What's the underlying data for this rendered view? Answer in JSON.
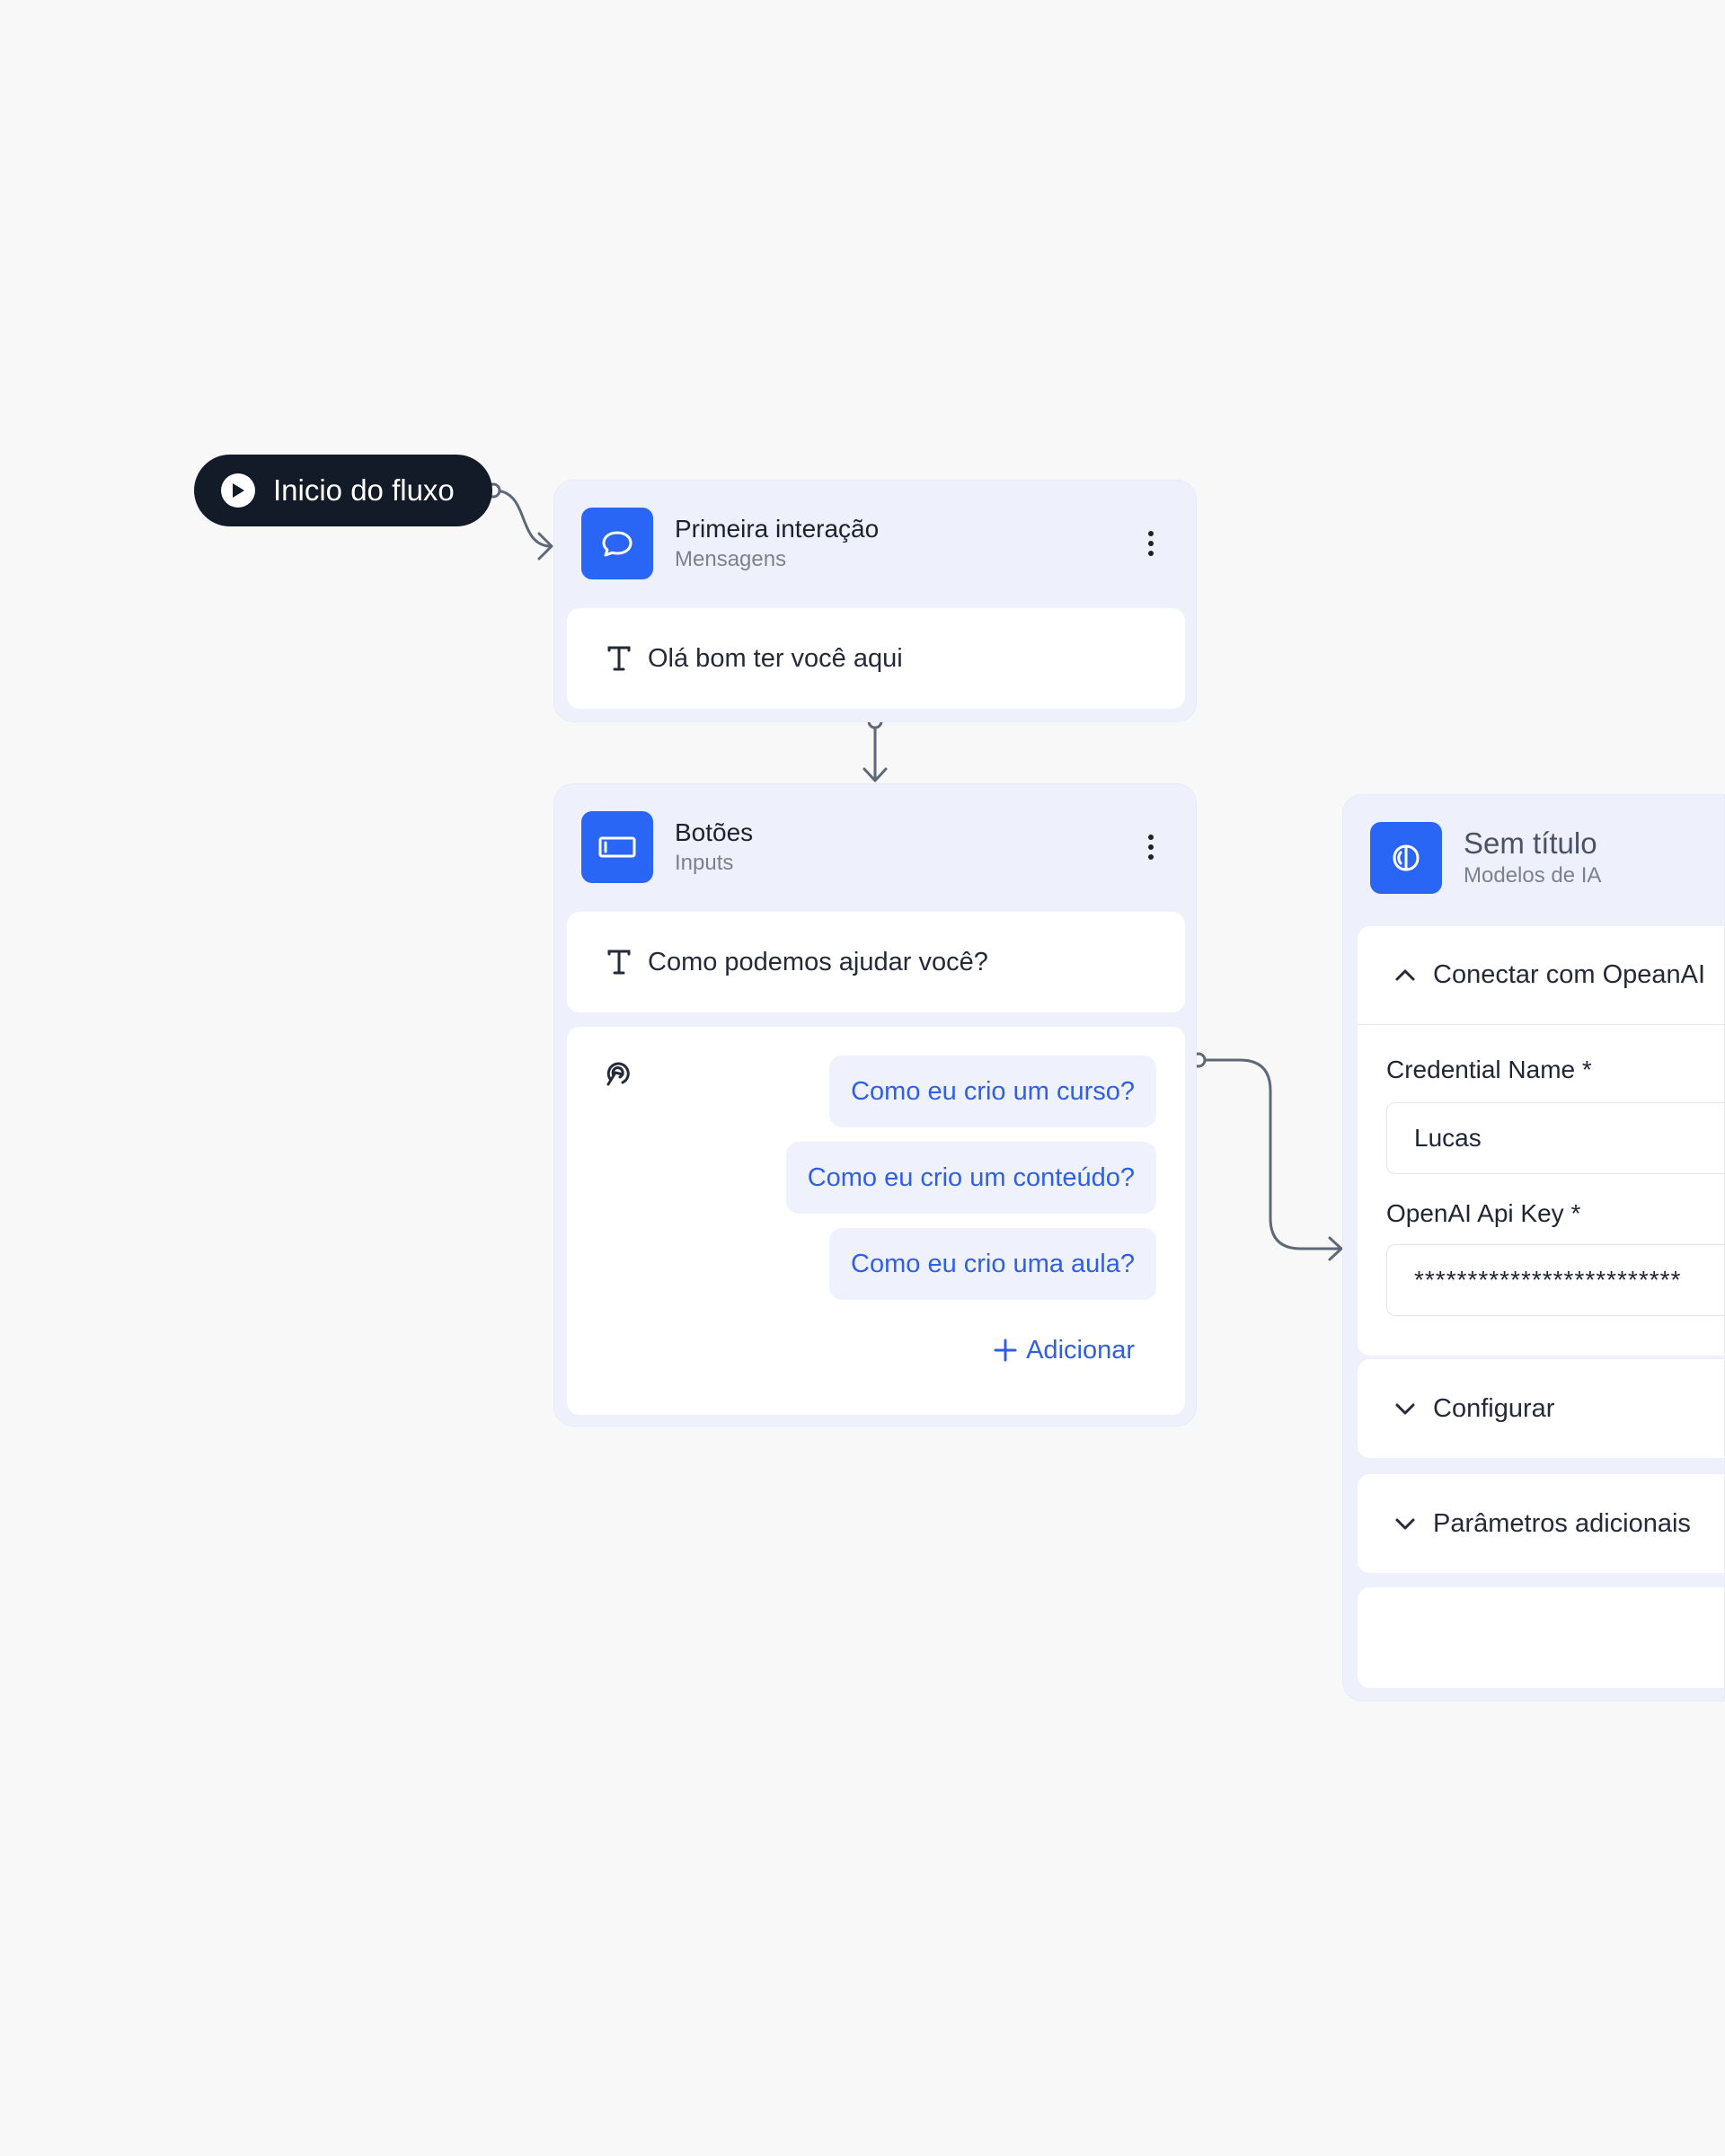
{
  "start": {
    "label": "Inicio do fluxo"
  },
  "node1": {
    "title": "Primeira interação",
    "subtitle": "Mensagens",
    "message": "Olá bom ter você aqui"
  },
  "node2": {
    "title": "Botões",
    "subtitle": "Inputs",
    "message": "Como podemos ajudar você?",
    "choices": [
      "Como eu crio um curso?",
      "Como eu crio um conteúdo?",
      "Como eu crio uma aula?"
    ],
    "add_label": "Adicionar"
  },
  "ai_node": {
    "title": "Sem título",
    "subtitle": "Modelos de IA",
    "connect_section": "Conectar com OpeanAI",
    "credential_label": "Credential Name *",
    "credential_value": "Lucas",
    "api_key_label": "OpenAI Api Key *",
    "api_key_value": "*************************",
    "configure_section": "Configurar",
    "params_section": "Parâmetros adicionais"
  },
  "colors": {
    "accent": "#2a66f6",
    "canvas": "#f8f8f9",
    "node_bg": "#eef1fb",
    "start_pill": "#131b29",
    "choice_text": "#2f5fe6",
    "connector": "#5d6878"
  },
  "icons": {
    "start": "play-circle-icon",
    "node1": "chat-bubble-icon",
    "node2": "button-input-icon",
    "ai_node": "brain-icon",
    "text": "text-t-icon",
    "choices": "pointer-click-icon",
    "menu": "kebab-menu-icon",
    "add": "plus-icon",
    "expanded": "chevron-up-icon",
    "collapsed": "chevron-down-icon"
  }
}
